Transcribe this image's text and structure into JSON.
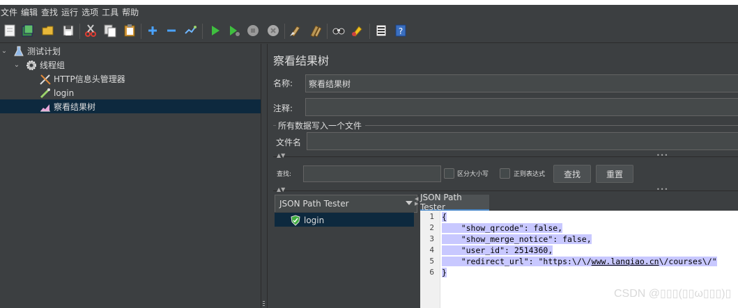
{
  "menu": [
    "文件",
    "编辑",
    "查找",
    "运行",
    "选项",
    "工具",
    "帮助"
  ],
  "toolbar": {
    "icons": [
      "new-icon",
      "templates-icon",
      "open-icon",
      "save-icon",
      "cut-icon",
      "copy-icon",
      "paste-icon",
      "add-icon",
      "remove-icon",
      "toggle-icon",
      "start-icon",
      "start-no-pause-icon",
      "stop-icon",
      "shutdown-icon",
      "clear-icon",
      "clear-all-icon",
      "search-icon",
      "reset-search-icon",
      "function-helper-icon",
      "help-icon"
    ]
  },
  "tree": {
    "test_plan": "测试计划",
    "thread_group": "线程组",
    "http_header": "HTTP信息头管理器",
    "login": "login",
    "view_results": "察看结果树"
  },
  "panel": {
    "title": "察看结果树",
    "name_label": "名称:",
    "name_value": "察看结果树",
    "comment_label": "注释:",
    "comment_value": "",
    "file_section": "所有数据写入一个文件",
    "filename_label": "文件名",
    "filename_value": "",
    "search_label": "查找:",
    "search_value": "",
    "case_label": "区分大小写",
    "regex_label": "正则表达式",
    "find_button": "查找",
    "reset_button": "重置"
  },
  "results": {
    "renderer": "JSON Path Tester",
    "items": [
      "login"
    ]
  },
  "tester": {
    "tab": "JSON Path Tester",
    "line_numbers": [
      "1",
      "2",
      "3",
      "4",
      "5",
      "6"
    ],
    "lines": [
      "{",
      "    \"show_qrcode\": false,",
      "    \"show_merge_notice\": false,",
      "    \"user_id\": 2514360,",
      "    \"redirect_url\": \"https:\\/\\/",
      "}"
    ],
    "url_text": "www.lanqiao.cn",
    "url_tail": "\\/courses\\/\""
  },
  "watermark": "CSDN @▯▯▯(▯▯ω▯▯▯)▯"
}
